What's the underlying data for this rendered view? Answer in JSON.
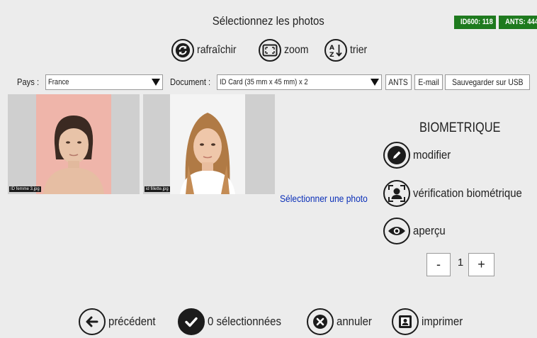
{
  "header": {
    "title": "Sélectionnez les photos",
    "badges": {
      "id600": "ID600: 118",
      "ants": "ANTS: 444"
    }
  },
  "toolbar": {
    "refresh": {
      "label": "rafraîchir",
      "icon": "refresh-icon"
    },
    "zoom": {
      "label": "zoom",
      "icon": "zoom-frame-icon"
    },
    "sort": {
      "label": "trier",
      "icon": "sort-az-icon"
    }
  },
  "filters": {
    "country_label": "Pays :",
    "country_value": "France",
    "document_label": "Document :",
    "document_value": "ID Card (35 mm x 45 mm) x 2",
    "ants_button": "ANTS",
    "email_button": "E-mail",
    "usb_button": "Sauvegarder sur USB"
  },
  "photos": [
    {
      "filename": "ID femme 3.jpg",
      "background": "#efb5aa"
    },
    {
      "filename": "id fillette.jpg",
      "background": "#f4f4f4"
    }
  ],
  "main": {
    "select_photo_link": "Sélectionner une photo"
  },
  "biometric_panel": {
    "title": "BIOMETRIQUE",
    "modify": {
      "label": "modifier",
      "icon": "pencil-icon"
    },
    "verify": {
      "label": "vérification biométrique",
      "icon": "face-scan-icon"
    },
    "preview": {
      "label": "aperçu",
      "icon": "eye-icon"
    },
    "quantity": {
      "minus": "-",
      "value": "1",
      "plus": "+"
    }
  },
  "bottom_bar": {
    "previous": {
      "label": "précédent",
      "icon": "arrow-left-icon"
    },
    "selected": {
      "label": "0 sélectionnées",
      "icon": "checkmark-icon"
    },
    "cancel": {
      "label": "annuler",
      "icon": "close-icon"
    },
    "print": {
      "label": "imprimer",
      "icon": "print-photo-icon"
    }
  },
  "colors": {
    "background": "#ececec",
    "badge_green": "#1e7a1e",
    "link_blue": "#0a2fb8",
    "icon_dark": "#1c1c1c"
  }
}
